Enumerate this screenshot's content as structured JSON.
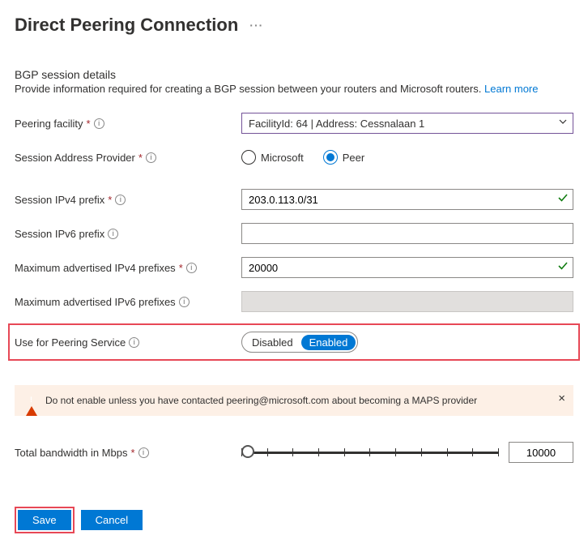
{
  "header": {
    "title": "Direct Peering Connection"
  },
  "section": {
    "title": "BGP session details",
    "subtitle": "Provide information required for creating a BGP session between your routers and Microsoft routers. ",
    "learn_more": "Learn more"
  },
  "labels": {
    "peering_facility": "Peering facility",
    "session_provider": "Session Address Provider",
    "ipv4_prefix": "Session IPv4 prefix",
    "ipv6_prefix": "Session IPv6 prefix",
    "max_ipv4": "Maximum advertised IPv4 prefixes",
    "max_ipv6": "Maximum advertised IPv6 prefixes",
    "peering_service": "Use for Peering Service",
    "bandwidth": "Total bandwidth in Mbps"
  },
  "values": {
    "peering_facility": "FacilityId: 64 | Address: Cessnalaan 1",
    "ipv4_prefix": "203.0.113.0/31",
    "ipv6_prefix": "",
    "max_ipv4": "20000",
    "max_ipv6": "",
    "bandwidth": "10000"
  },
  "radios": {
    "microsoft": "Microsoft",
    "peer": "Peer"
  },
  "toggle": {
    "disabled": "Disabled",
    "enabled": "Enabled"
  },
  "alert": {
    "text": "Do not enable unless you have contacted peering@microsoft.com about becoming a MAPS provider"
  },
  "buttons": {
    "save": "Save",
    "cancel": "Cancel"
  }
}
